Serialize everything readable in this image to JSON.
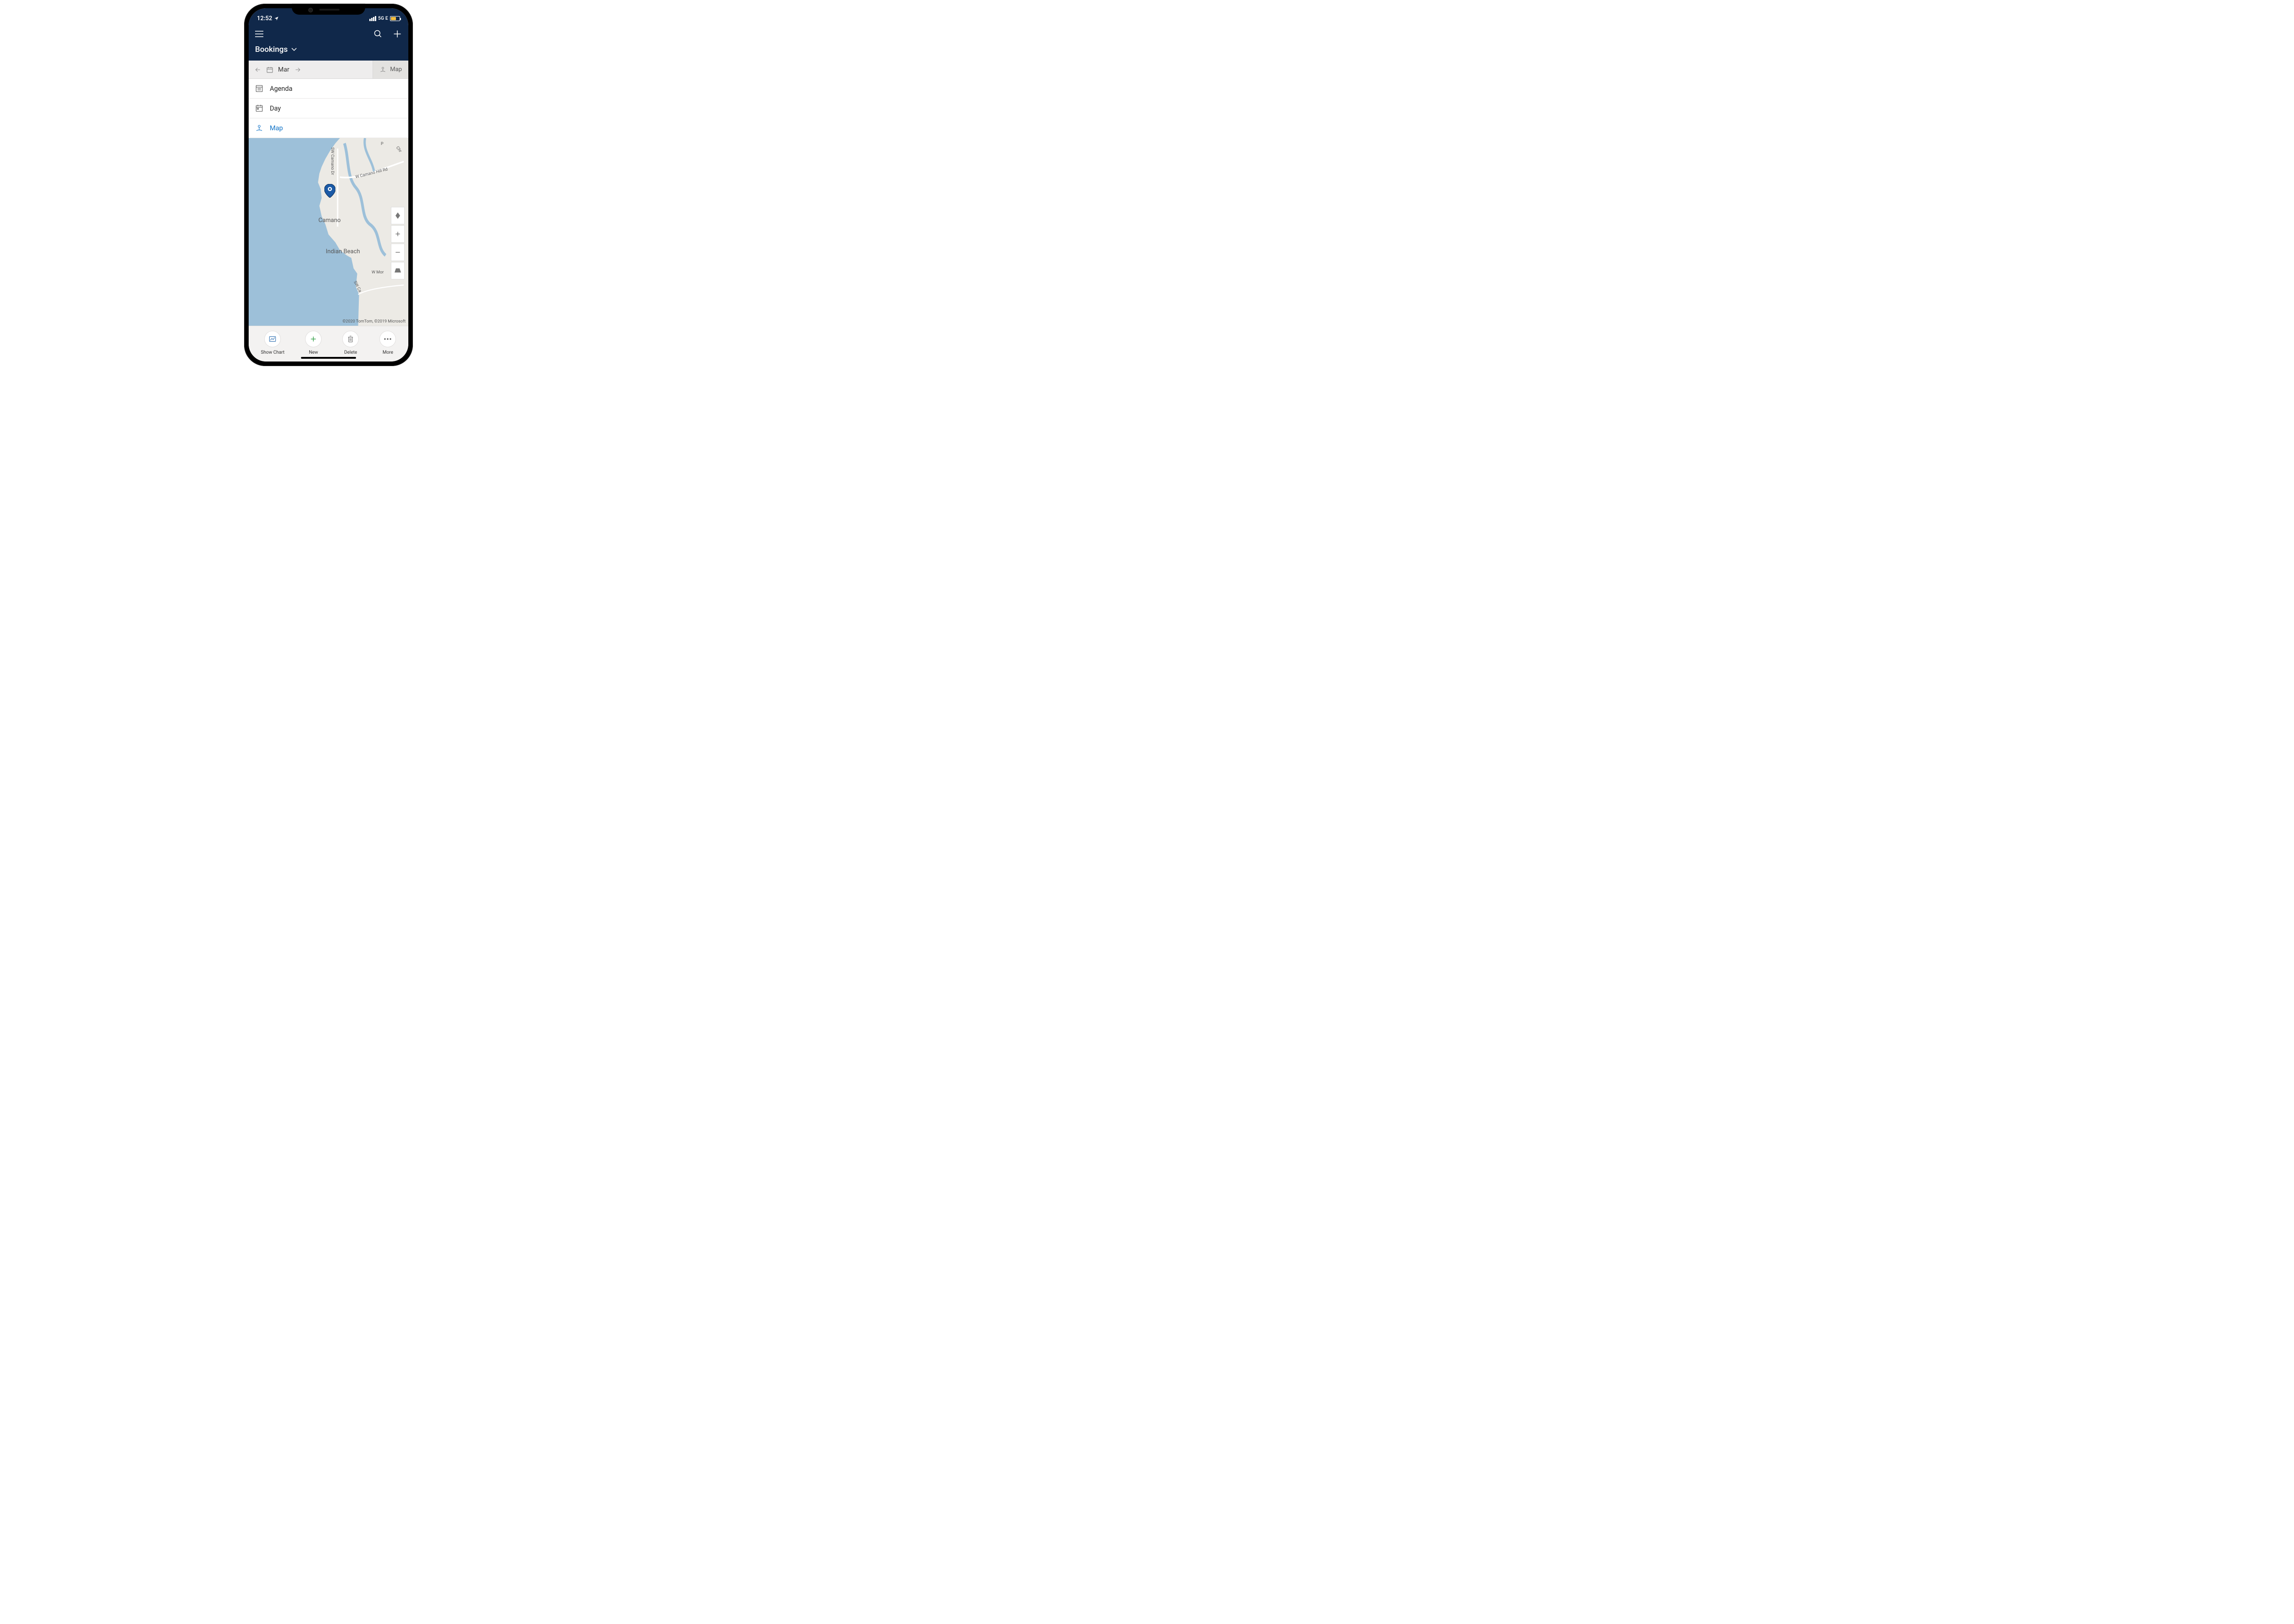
{
  "status": {
    "time": "12:52",
    "network_label": "5G E"
  },
  "header": {
    "title": "Bookings"
  },
  "monthbar": {
    "month": "Mar",
    "map_toggle": "Map"
  },
  "views": {
    "agenda": "Agenda",
    "day": "Day",
    "map": "Map"
  },
  "map": {
    "place_camano": "Camano",
    "place_indian_beach": "Indian Beach",
    "road_sw_camano_dr": "SW Camano Dr",
    "road_w_camano_hill": "W Camano Hill Rd",
    "road_chr": "Chr",
    "road_p": "P",
    "road_w_mor": "W Mor",
    "road_sw_ca": "SW Ca",
    "attribution": "©2020 TomTom, ©2019 Microsoft"
  },
  "bottombar": {
    "show_chart": "Show Chart",
    "new": "New",
    "delete": "Delete",
    "more": "More"
  }
}
